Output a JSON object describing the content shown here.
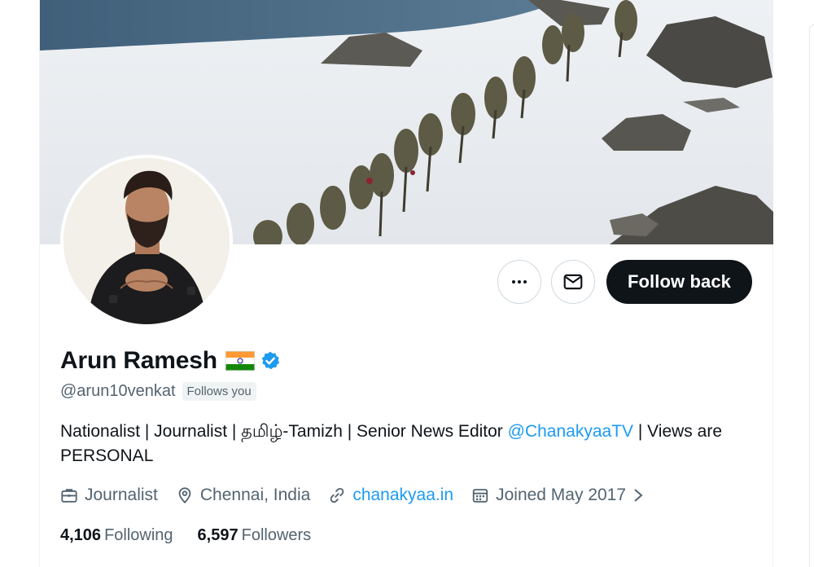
{
  "profile": {
    "display_name": "Arun Ramesh",
    "handle": "@arun10venkat",
    "follows_you": "Follows you",
    "bio_text_1": "Nationalist | Journalist | தமிழ்-Tamizh | Senior News Editor ",
    "bio_mention": "@ChanakyaaTV",
    "bio_text_2": " | Views are PERSONAL"
  },
  "actions": {
    "more_icon": "more-horizontal-icon",
    "message_icon": "envelope-icon",
    "follow_label": "Follow back"
  },
  "meta": {
    "profession": "Journalist",
    "location": "Chennai, India",
    "website": "chanakyaa.in",
    "joined": "Joined May 2017"
  },
  "stats": {
    "following_count": "4,106",
    "following_label": "Following",
    "followers_count": "6,597",
    "followers_label": "Followers"
  },
  "colors": {
    "link": "#1d9bf0",
    "text_primary": "#0f1419",
    "text_secondary": "#536471",
    "follow_button": "#0f1419",
    "verified": "#1d9bf0"
  }
}
